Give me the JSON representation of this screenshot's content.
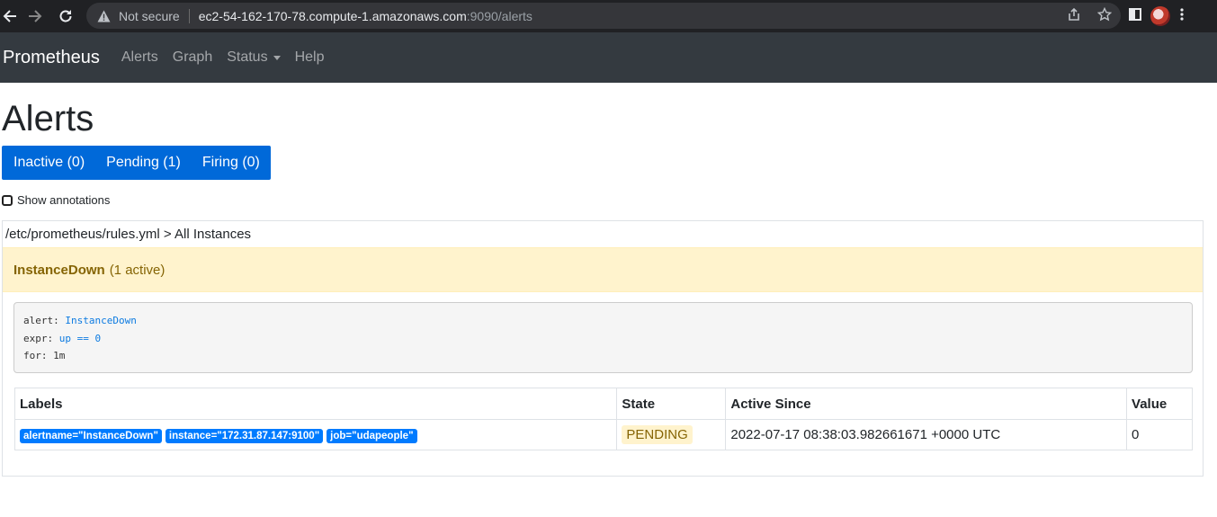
{
  "browser": {
    "security_text": "Not secure",
    "url_host": "ec2-54-162-170-78.compute-1.amazonaws.com",
    "url_path": ":9090/alerts"
  },
  "navbar": {
    "brand": "Prometheus",
    "links": [
      "Alerts",
      "Graph",
      "Status",
      "Help"
    ]
  },
  "page": {
    "title": "Alerts",
    "tabs": [
      "Inactive (0)",
      "Pending (1)",
      "Firing (0)"
    ],
    "show_annotations_label": "Show annotations"
  },
  "rule_group": {
    "header": "/etc/prometheus/rules.yml > All Instances",
    "alert_name": "InstanceDown",
    "active_count": "(1 active)",
    "rule": {
      "alert_key": "alert:",
      "alert_val": "InstanceDown",
      "expr_key": "expr:",
      "expr_val": "up == 0",
      "for_key": "for:",
      "for_val": "1m"
    }
  },
  "table": {
    "headers": [
      "Labels",
      "State",
      "Active Since",
      "Value"
    ],
    "rows": [
      {
        "labels": [
          "alertname=\"InstanceDown\"",
          "instance=\"172.31.87.147:9100\"",
          "job=\"udapeople\""
        ],
        "state": "PENDING",
        "active_since": "2022-07-17 08:38:03.982661671 +0000 UTC",
        "value": "0"
      }
    ]
  },
  "colors": {
    "navbar_bg": "#343a40",
    "primary": "#007bff",
    "warning_bg": "#fff3cd",
    "warning_text": "#856404"
  }
}
